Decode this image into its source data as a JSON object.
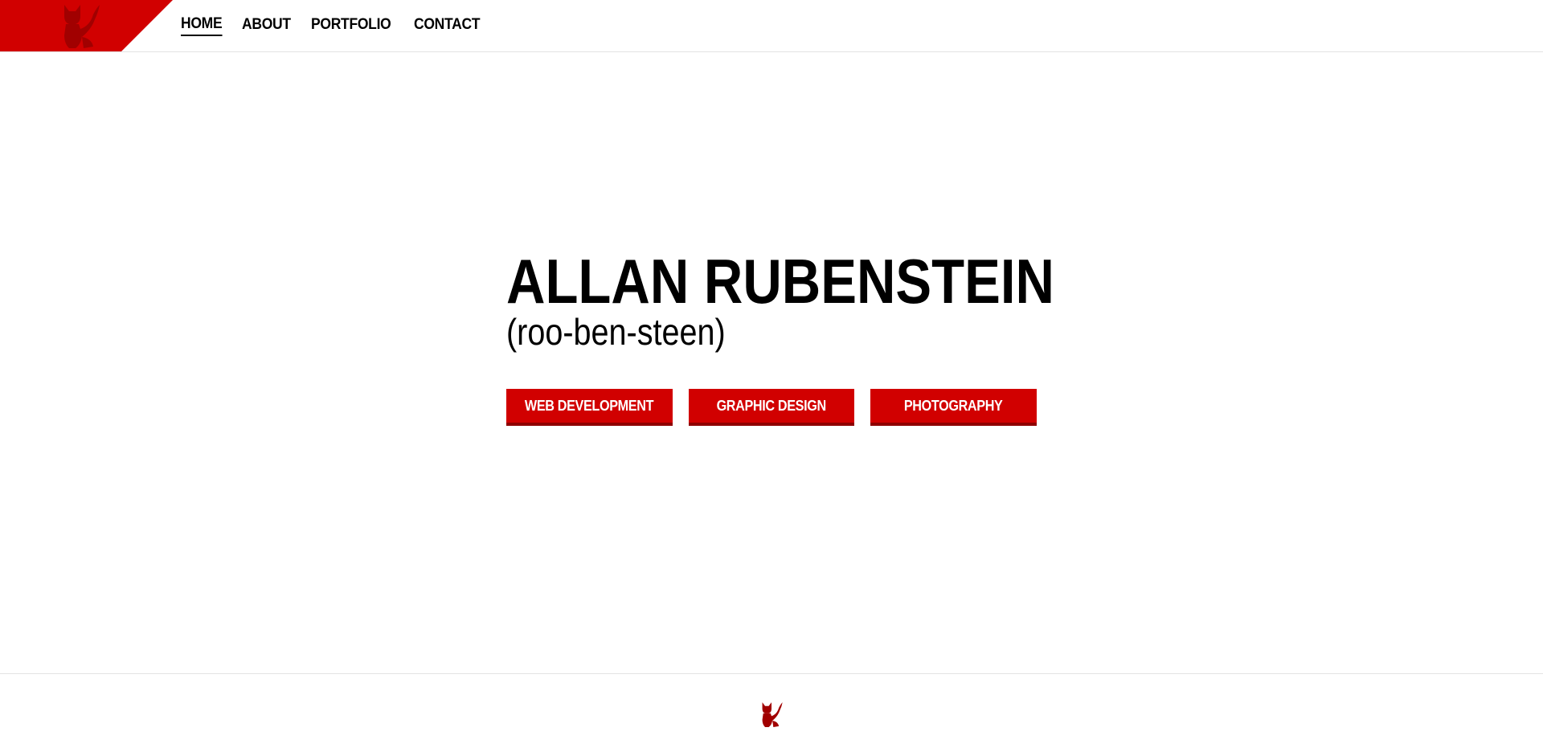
{
  "header": {
    "logo_icon": "cat-fox-logo-icon",
    "nav": [
      {
        "label": "HOME",
        "active": true
      },
      {
        "label": "ABOUT",
        "active": false
      },
      {
        "label": "PORTFOLIO",
        "active": false
      },
      {
        "label": "CONTACT",
        "active": false
      }
    ]
  },
  "hero": {
    "title": "ALLAN RUBENSTEIN",
    "subtitle": "(roo-ben-steen)"
  },
  "buttons": {
    "web": "WEB DEVELOPMENT",
    "graphic": "GRAPHIC DESIGN",
    "photo": "PHOTOGRAPHY"
  },
  "footer": {
    "logo_icon": "cat-fox-logo-icon"
  },
  "colors": {
    "accent": "#d10000",
    "accent_dark": "#8f0000",
    "text": "#000000",
    "divider": "#e3e3e3"
  }
}
